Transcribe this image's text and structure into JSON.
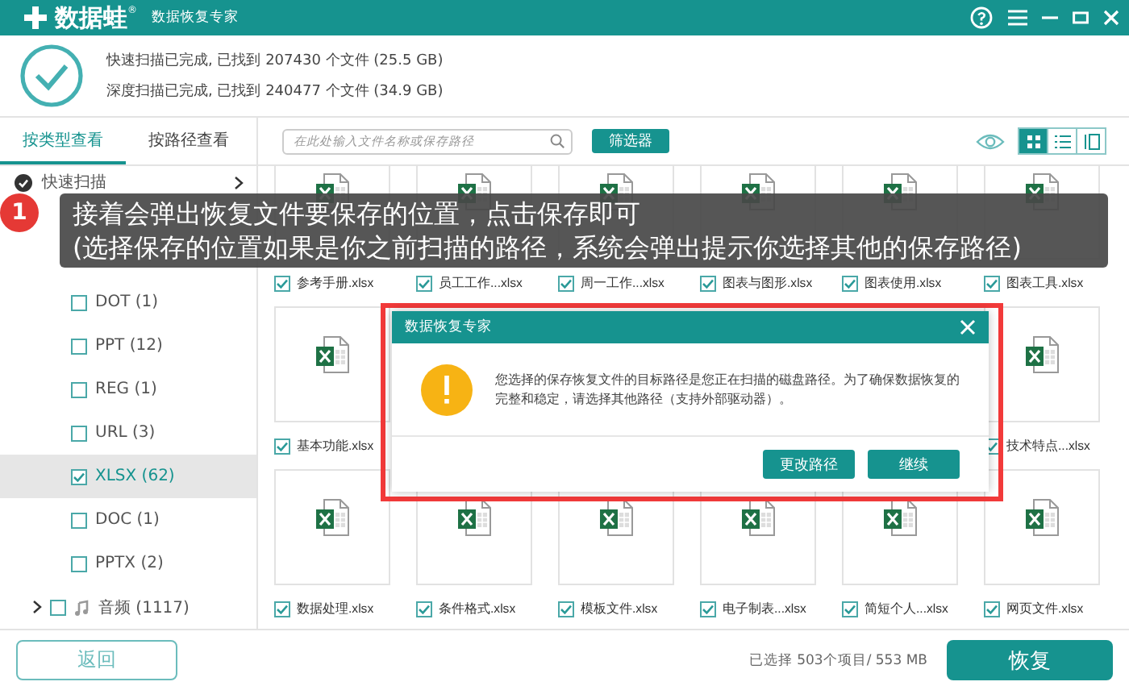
{
  "title_bar": {
    "logo": "数据蛙",
    "logo_mark": "®",
    "subtitle": "数据恢复专家"
  },
  "scan_summary": [
    "快速扫描已完成, 已找到 207430 个文件 (25.5 GB)",
    "深度扫描已完成, 已找到 240477 个文件 (34.9 GB)"
  ],
  "view_tabs": [
    {
      "label": "按类型查看",
      "selected": true
    },
    {
      "label": "按路径查看",
      "selected": false
    }
  ],
  "scan_list": [
    "快速扫描"
  ],
  "categories": [
    {
      "kind": "type",
      "label": "DOT (1)",
      "checked": false,
      "selected": false
    },
    {
      "kind": "type",
      "label": "PPT (12)",
      "checked": false,
      "selected": false
    },
    {
      "kind": "type",
      "label": "REG (1)",
      "checked": false,
      "selected": false
    },
    {
      "kind": "type",
      "label": "URL (3)",
      "checked": false,
      "selected": false
    },
    {
      "kind": "type",
      "label": "XLSX (62)",
      "checked": true,
      "selected": true
    },
    {
      "kind": "type",
      "label": "DOC (1)",
      "checked": false,
      "selected": false
    },
    {
      "kind": "type",
      "label": "PPTX (2)",
      "checked": false,
      "selected": false
    },
    {
      "kind": "group",
      "label": "音频 (1117)",
      "checked": false,
      "selected": false
    }
  ],
  "search": {
    "placeholder": "在此处输入文件名称或保存路径"
  },
  "filter_button": "筛选器",
  "view_modes": [
    {
      "kind": "grid",
      "selected": true
    },
    {
      "kind": "list",
      "selected": false
    },
    {
      "kind": "detail",
      "selected": false
    }
  ],
  "file_rows": [
    [
      {
        "name": "参考手册.xlsx",
        "checked": true
      },
      {
        "name": "员工工作...xlsx",
        "checked": true
      },
      {
        "name": "周一工作...xlsx",
        "checked": true
      },
      {
        "name": "图表与图形.xlsx",
        "checked": true
      },
      {
        "name": "图表使用.xlsx",
        "checked": true
      },
      {
        "name": "图表工具.xlsx",
        "checked": true
      }
    ],
    [
      {
        "name": "基本功能.xlsx",
        "checked": true
      },
      {
        "name": "技术特点...xlsx",
        "checked": true
      }
    ],
    [
      {
        "name": "数据处理.xlsx",
        "checked": true
      },
      {
        "name": "条件格式.xlsx",
        "checked": true
      },
      {
        "name": "模板文件.xlsx",
        "checked": true
      },
      {
        "name": "电子制表...xlsx",
        "checked": true
      },
      {
        "name": "简短个人...xlsx",
        "checked": true
      },
      {
        "name": "网页文件.xlsx",
        "checked": true
      }
    ]
  ],
  "selection_summary": "已选择 503个项目/ 553 MB",
  "back_button": "返回",
  "recover_button": "恢复",
  "guide_tip": {
    "step": "1",
    "lines": [
      "接着会弹出恢复文件要保存的位置，点击保存即可",
      "(选择保存的位置如果是你之前扫描的路径，系统会弹出提示你选择其他的保存路径)"
    ]
  },
  "dialog": {
    "title": "数据恢复专家",
    "message": "您选择的保存恢复文件的目标路径是您正在扫描的磁盘路径。为了确保数据恢复的完整和稳定，请选择其他路径（支持外部驱动器）。",
    "buttons": [
      "更改路径",
      "继续"
    ]
  }
}
